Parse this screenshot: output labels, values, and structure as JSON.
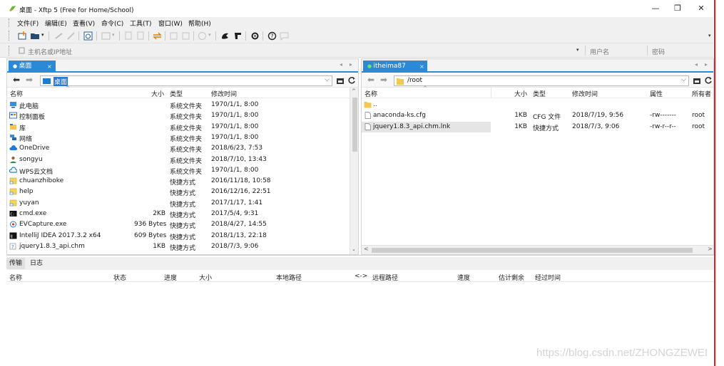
{
  "window": {
    "title": "桌面 - Xftp 5 (Free for Home/School)",
    "minimize": "—",
    "maximize": "❐",
    "close": "✕"
  },
  "menu": [
    "文件(F)",
    "编辑(E)",
    "查看(V)",
    "命令(C)",
    "工具(T)",
    "窗口(W)",
    "帮助(H)"
  ],
  "address": {
    "host_placeholder": "主机名或IP地址",
    "user_placeholder": "用户名",
    "password_placeholder": "密码"
  },
  "local": {
    "tab": "桌面",
    "tab_close": "×",
    "path": "桌面",
    "columns": [
      "名称",
      "大小",
      "类型",
      "修改时间"
    ],
    "files": [
      {
        "name": "此电脑",
        "size": "",
        "type": "系统文件夹",
        "modified": "1970/1/1, 8:00",
        "icon": "computer-icon"
      },
      {
        "name": "控制面板",
        "size": "",
        "type": "系统文件夹",
        "modified": "1970/1/1, 8:00",
        "icon": "control-panel-icon"
      },
      {
        "name": "库",
        "size": "",
        "type": "系统文件夹",
        "modified": "1970/1/1, 8:00",
        "icon": "library-icon"
      },
      {
        "name": "网络",
        "size": "",
        "type": "系统文件夹",
        "modified": "1970/1/1, 8:00",
        "icon": "network-icon"
      },
      {
        "name": "OneDrive",
        "size": "",
        "type": "系统文件夹",
        "modified": "2018/6/23, 7:53",
        "icon": "cloud-icon"
      },
      {
        "name": "songyu",
        "size": "",
        "type": "系统文件夹",
        "modified": "2018/7/10, 13:43",
        "icon": "user-icon"
      },
      {
        "name": "WPS云文档",
        "size": "",
        "type": "系统文件夹",
        "modified": "1970/1/1, 8:00",
        "icon": "wps-cloud-icon"
      },
      {
        "name": "chuanzhiboke",
        "size": "",
        "type": "快捷方式",
        "modified": "2016/11/18, 10:58",
        "icon": "shortcut-icon"
      },
      {
        "name": "help",
        "size": "",
        "type": "快捷方式",
        "modified": "2016/12/16, 22:51",
        "icon": "shortcut-icon"
      },
      {
        "name": "yuyan",
        "size": "",
        "type": "快捷方式",
        "modified": "2017/1/17, 1:41",
        "icon": "shortcut-icon"
      },
      {
        "name": "cmd.exe",
        "size": "2KB",
        "type": "快捷方式",
        "modified": "2017/5/4, 9:31",
        "icon": "cmd-icon"
      },
      {
        "name": "EVCapture.exe",
        "size": "936 Bytes",
        "type": "快捷方式",
        "modified": "2018/4/27, 14:55",
        "icon": "capture-icon"
      },
      {
        "name": "IntelliJ IDEA 2017.3.2 x64",
        "size": "609 Bytes",
        "type": "快捷方式",
        "modified": "2018/1/13, 22:18",
        "icon": "idea-icon"
      },
      {
        "name": "jquery1.8.3_api.chm",
        "size": "1KB",
        "type": "快捷方式",
        "modified": "2018/7/3, 9:06",
        "icon": "chm-icon"
      }
    ]
  },
  "remote": {
    "tab": "itheima87",
    "tab_close": "×",
    "path": "/root",
    "columns": [
      "名称",
      "大小",
      "类型",
      "修改时间",
      "属性",
      "所有者"
    ],
    "files": [
      {
        "name": "..",
        "size": "",
        "type": "",
        "modified": "",
        "attr": "",
        "owner": "",
        "icon": "folder-up-icon"
      },
      {
        "name": "anaconda-ks.cfg",
        "size": "1KB",
        "type": "CFG 文件",
        "modified": "2018/7/19, 9:56",
        "attr": "-rw-------",
        "owner": "root",
        "icon": "file-icon"
      },
      {
        "name": "jquery1.8.3_api.chm.lnk",
        "size": "1KB",
        "type": "快捷方式",
        "modified": "2018/7/3, 9:06",
        "attr": "-rw-r--r--",
        "owner": "root",
        "icon": "file-icon"
      }
    ]
  },
  "transfer": {
    "tabs": [
      "传输",
      "日志"
    ],
    "columns": [
      "名称",
      "状态",
      "进度",
      "大小",
      "本地路径",
      "<->",
      "远程路径",
      "速度",
      "估计剩余",
      "经过时间"
    ]
  },
  "watermark": "https://blog.csdn.net/ZHONGZEWEI",
  "colors": {
    "accent": "#2b8ad8",
    "chrome": "#f0f0f0",
    "selection": "#e5e5e5",
    "border_red": "#e02020"
  }
}
